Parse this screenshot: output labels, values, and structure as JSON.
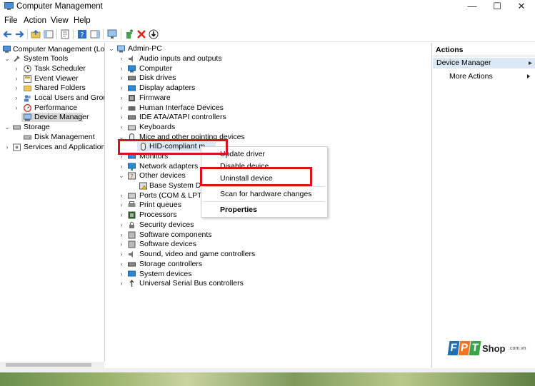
{
  "window": {
    "title": "Computer Management",
    "minimize": "—",
    "maximize": "☐",
    "close": "✕"
  },
  "menu": [
    "File",
    "Action",
    "View",
    "Help"
  ],
  "left_tree": {
    "root": "Computer Management (Local",
    "system_tools": "System Tools",
    "task_scheduler": "Task Scheduler",
    "event_viewer": "Event Viewer",
    "shared_folders": "Shared Folders",
    "local_users": "Local Users and Groups",
    "performance": "Performance",
    "device_manager": "Device Manager",
    "storage": "Storage",
    "disk_management": "Disk Management",
    "services": "Services and Applications"
  },
  "device_tree": {
    "computer": "Admin-PC",
    "categories": {
      "audio": "Audio inputs and outputs",
      "computer": "Computer",
      "disk": "Disk drives",
      "display": "Display adapters",
      "firmware": "Firmware",
      "hid": "Human Interface Devices",
      "ide": "IDE ATA/ATAPI controllers",
      "keyboards": "Keyboards",
      "mice": "Mice and other pointing devices",
      "hid_mouse": "HID-compliant m",
      "monitors": "Monitors",
      "network": "Network adapters",
      "other": "Other devices",
      "base_system": "Base System Devic",
      "ports": "Ports (COM & LPT)",
      "print": "Print queues",
      "processors": "Processors",
      "security": "Security devices",
      "sw_components": "Software components",
      "sw_devices": "Software devices",
      "sound": "Sound, video and game controllers",
      "storage_ctrl": "Storage controllers",
      "system_devices": "System devices",
      "usb": "Universal Serial Bus controllers"
    }
  },
  "context_menu": {
    "update_driver": "Update driver",
    "disable_device": "Disable device",
    "uninstall_device": "Uninstall device",
    "scan_hardware": "Scan for hardware changes",
    "properties": "Properties"
  },
  "actions": {
    "header": "Actions",
    "section": "Device Manager",
    "more": "More Actions"
  },
  "brand": {
    "fpt": "FPT",
    "shop": "Shop",
    "domain": ".com.vn"
  },
  "colors": {
    "highlight": "#d7141a",
    "selection": "#d9d9d9",
    "action_bg": "#dce8f5",
    "brand_blue": "#1f6fb5",
    "brand_orange": "#f27321",
    "brand_green": "#3aa548"
  }
}
